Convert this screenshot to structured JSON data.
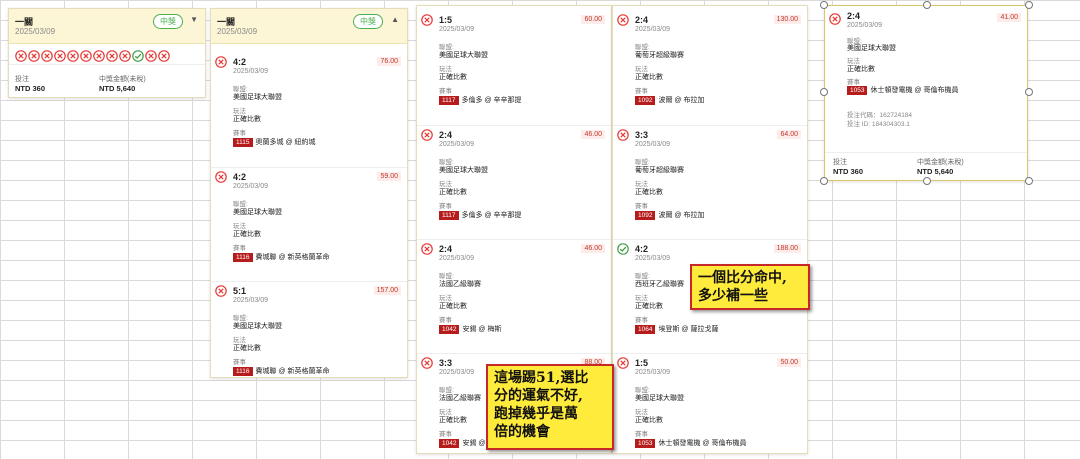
{
  "card_summary": {
    "title": "一關",
    "date": "2025/03/09",
    "status": "中獎",
    "stake_label": "投注",
    "stake": "NTD 360",
    "payout_label": "中獎金額(未稅)",
    "payout": "NTD 5,640",
    "results": [
      "lose",
      "lose",
      "lose",
      "lose",
      "lose",
      "lose",
      "lose",
      "lose",
      "lose",
      "win",
      "lose",
      "lose"
    ]
  },
  "card_detail": {
    "title": "一關",
    "date": "2025/03/09",
    "status": "中獎"
  },
  "labels": {
    "league": "聯盟:",
    "play": "玩法",
    "event": "賽事",
    "play_value": "正確比數"
  },
  "col1": [
    {
      "score": "4:2",
      "date": "2025/03/09",
      "odds": "76.00",
      "result": "lose",
      "league": "美國足球大聯盟",
      "match_no": "1115",
      "match": "奧蘭多城 @ 紐約城"
    },
    {
      "score": "4:2",
      "date": "2025/03/09",
      "odds": "59.00",
      "result": "lose",
      "league": "美國足球大聯盟",
      "match_no": "1116",
      "match": "費城聯 @ 新英格蘭革命"
    },
    {
      "score": "5:1",
      "date": "2025/03/09",
      "odds": "157.00",
      "result": "lose",
      "league": "美國足球大聯盟",
      "match_no": "1116",
      "match": "費城聯 @ 新英格蘭革命"
    }
  ],
  "col2": [
    {
      "score": "1:5",
      "date": "2025/03/09",
      "odds": "60.00",
      "result": "lose",
      "league": "美國足球大聯盟",
      "match_no": "1117",
      "match": "多倫多 @ 辛辛那提"
    },
    {
      "score": "2:4",
      "date": "2025/03/09",
      "odds": "46.00",
      "result": "lose",
      "league": "美國足球大聯盟",
      "match_no": "1117",
      "match": "多倫多 @ 辛辛那提"
    },
    {
      "score": "2:4",
      "date": "2025/03/09",
      "odds": "46.00",
      "result": "lose",
      "league": "法國乙級聯賽",
      "match_no": "1042",
      "match": "安錫 @ 梅斯"
    },
    {
      "score": "3:3",
      "date": "2025/03/09",
      "odds": "88.00",
      "result": "lose",
      "league": "法國乙級聯賽",
      "match_no": "1042",
      "match": "安錫 @"
    }
  ],
  "col3": [
    {
      "score": "2:4",
      "date": "2025/03/09",
      "odds": "130.00",
      "result": "lose",
      "league": "葡萄牙超級聯賽",
      "match_no": "1092",
      "match": "波爾 @ 布拉加"
    },
    {
      "score": "3:3",
      "date": "2025/03/09",
      "odds": "64.00",
      "result": "lose",
      "league": "葡萄牙超級聯賽",
      "match_no": "1092",
      "match": "波爾 @ 布拉加"
    },
    {
      "score": "4:2",
      "date": "2025/03/09",
      "odds": "188.00",
      "result": "win",
      "league": "西班牙乙級聯賽",
      "match_no": "1064",
      "match": "埃登斯 @ 薩拉戈薩"
    },
    {
      "score": "1:5",
      "date": "2025/03/09",
      "odds": "50.00",
      "result": "lose",
      "league": "美國足球大聯盟",
      "match_no": "1053",
      "match": "休士頓發電機 @ 哥倫布機員"
    }
  ],
  "col4": {
    "score": "2:4",
    "date": "2025/03/09",
    "odds": "41.00",
    "result": "lose",
    "league": "美國足球大聯盟",
    "match_no": "1053",
    "match": "休士頓發電機 @ 哥倫布機員",
    "bet_code": "投注代碼：162724184",
    "bet_id": "投注 ID: 184304303.1",
    "stake_label": "投注",
    "stake": "NTD 360",
    "payout_label": "中獎金額(未稅)",
    "payout": "NTD 5,640"
  },
  "notes": {
    "note1": "一個比分命中,\n多少補一些",
    "note2": "這場踢51,選比\n分的運氣不好,\n跑掉幾乎是萬\n倍的機會"
  },
  "colors": {
    "lose": "#e53935",
    "win": "#43a047",
    "odds": "#c0392b",
    "match_bg": "#b71c1c",
    "note_bg": "#ffeb3b",
    "note_border": "#c62828"
  }
}
